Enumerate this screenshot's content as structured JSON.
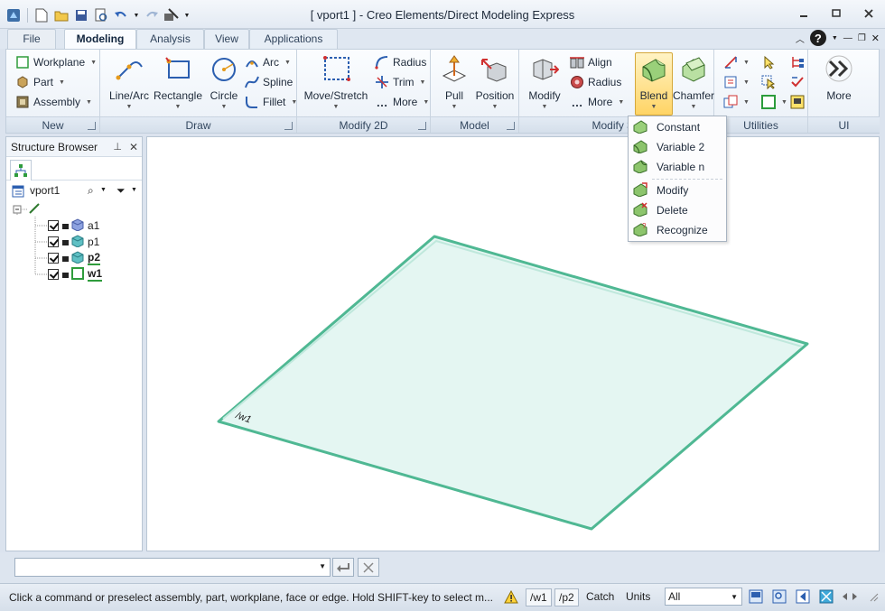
{
  "window": {
    "title": "[ vport1 ] - Creo Elements/Direct Modeling Express"
  },
  "tabs": [
    {
      "label": "File"
    },
    {
      "label": "Modeling"
    },
    {
      "label": "Analysis"
    },
    {
      "label": "View"
    },
    {
      "label": "Applications"
    }
  ],
  "ribbon": {
    "new": {
      "label": "New",
      "workplane": "Workplane",
      "part": "Part",
      "assembly": "Assembly"
    },
    "draw": {
      "label": "Draw",
      "line_arc": "Line/Arc",
      "rectangle": "Rectangle",
      "circle": "Circle",
      "arc": "Arc",
      "spline": "Spline",
      "fillet": "Fillet"
    },
    "modify2d": {
      "label": "Modify 2D",
      "move_stretch": "Move/Stretch",
      "radius": "Radius",
      "trim": "Trim",
      "more": "More"
    },
    "model": {
      "label": "Model",
      "pull": "Pull",
      "position": "Position"
    },
    "modify3d": {
      "label": "Modify 3D",
      "modify": "Modify",
      "align": "Align",
      "radius": "Radius",
      "more": "More",
      "blend": "Blend",
      "chamfer": "Chamfer"
    },
    "utilities": {
      "label": "Utilities"
    },
    "ui": {
      "label": "UI",
      "more": "More"
    }
  },
  "blend_menu": {
    "items": [
      {
        "label": "Constant"
      },
      {
        "label": "Variable 2"
      },
      {
        "label": "Variable n"
      },
      {
        "label": "Modify"
      },
      {
        "label": "Delete"
      },
      {
        "label": "Recognize"
      }
    ]
  },
  "browser": {
    "title": "Structure Browser",
    "view_name": "vport1",
    "items": [
      {
        "label": "a1"
      },
      {
        "label": "p1"
      },
      {
        "label": "p2"
      },
      {
        "label": "w1"
      }
    ]
  },
  "viewport": {
    "workplane_label": "/w1"
  },
  "status": {
    "message": "Click a command or preselect assembly, part, workplane, face or edge. Hold SHIFT-key to select m...",
    "workplane": "/w1",
    "part": "/p2",
    "catch": "Catch",
    "units": "Units",
    "filter": "All"
  },
  "colors": {
    "accent": "#2f8f6f",
    "workplane_fill": "#e4f6f2",
    "workplane_edge": "#4fb893",
    "blend_highlight": "#ffd465"
  }
}
